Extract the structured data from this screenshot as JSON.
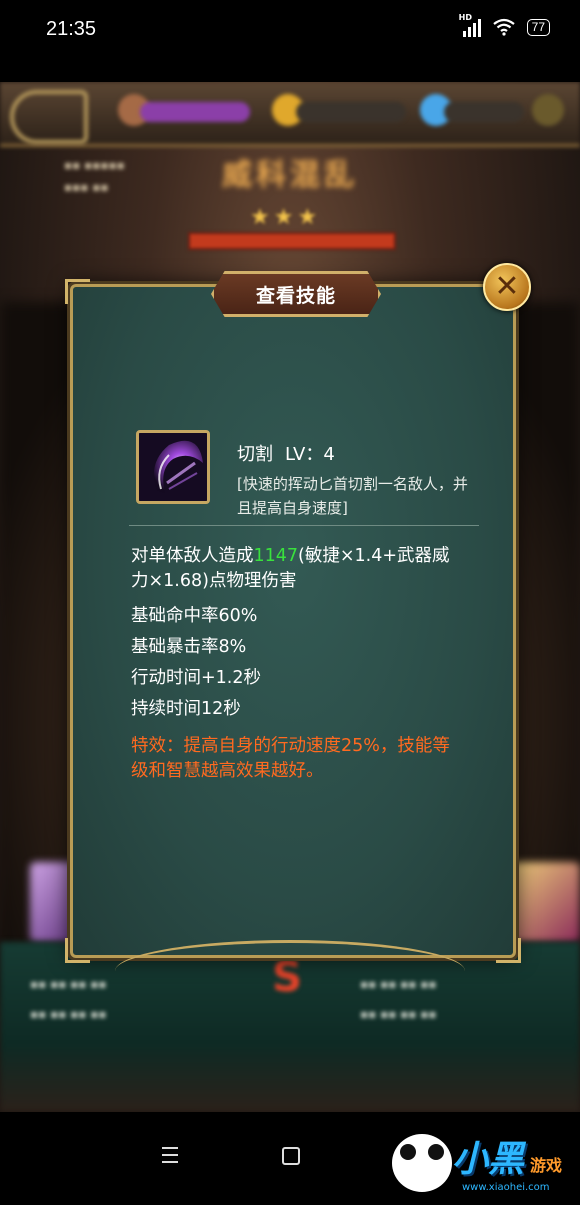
{
  "status_bar": {
    "time": "21:35",
    "battery": "77",
    "network": "HD"
  },
  "dialog": {
    "title": "查看技能",
    "close_glyph": "✕",
    "skill": {
      "name": "切割",
      "level": "LV：4",
      "description": "[快速的挥动匕首切割一名敌人，并且提高自身速度]"
    },
    "effect": {
      "damage_prefix": "对单体敌人造成",
      "damage_value": "1147",
      "damage_suffix": "(敏捷×1.4+武器威力×1.68)点物理伤害",
      "hit_rate": "基础命中率60%",
      "crit_rate": "基础暴击率8%",
      "action_time": "行动时间+1.2秒",
      "duration": "持续时间12秒",
      "special": "特效：提高自身的行动速度25%，技能等级和智慧越高效果越好。"
    }
  },
  "background_game": {
    "title": "威科混乱"
  },
  "colors": {
    "panel": "#2a4b46",
    "gold_border": "#b99c55",
    "highlight_green": "#39e13d",
    "special_orange": "#ff6a20"
  },
  "watermark": {
    "brand": "小黑",
    "tag": "游戏",
    "url": "www.xiaohei.com"
  },
  "icons": [
    "back-icon",
    "close-icon",
    "skill-dagger-icon",
    "menu-icon",
    "home-icon",
    "wifi-icon",
    "signal-icon",
    "battery-icon"
  ]
}
